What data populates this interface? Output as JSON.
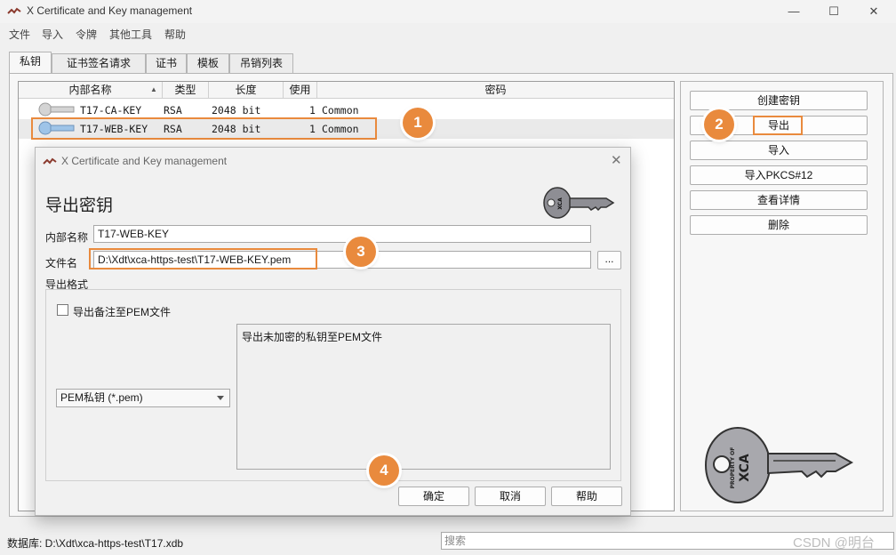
{
  "window": {
    "title": "X Certificate and Key management"
  },
  "menu": [
    "文件",
    "导入",
    "令牌",
    "其他工具",
    "帮助"
  ],
  "tabs": [
    "私钥",
    "证书签名请求",
    "证书",
    "模板",
    "吊销列表"
  ],
  "table": {
    "columns": [
      "内部名称",
      "类型",
      "长度",
      "使用",
      "密码"
    ],
    "rows": [
      {
        "name": "T17-CA-KEY",
        "type": "RSA",
        "length": "2048 bit",
        "use": "1",
        "password": "Common"
      },
      {
        "name": "T17-WEB-KEY",
        "type": "RSA",
        "length": "2048 bit",
        "use": "1",
        "password": "Common"
      }
    ]
  },
  "side_buttons": [
    "创建密钥",
    "导出",
    "导入",
    "导入PKCS#12",
    "查看详情",
    "删除"
  ],
  "dialog": {
    "title": "X Certificate and Key management",
    "heading": "导出密钥",
    "internal_name_label": "内部名称",
    "internal_name_value": "T17-WEB-KEY",
    "filename_label": "文件名",
    "filename_value": "D:\\Xdt\\xca-https-test\\T17-WEB-KEY.pem",
    "browse_label": "...",
    "format_label": "导出格式",
    "checkbox_label": "导出备注至PEM文件",
    "format_selected": "PEM私钥 (*.pem)",
    "description": "导出未加密的私钥至PEM文件",
    "ok_label": "确定",
    "cancel_label": "取消",
    "help_label": "帮助"
  },
  "status": {
    "database": "数据库: D:\\Xdt\\xca-https-test\\T17.xdb",
    "search_placeholder": "搜索",
    "watermark": "CSDN @明台"
  },
  "markers": [
    "1",
    "2",
    "3",
    "4"
  ],
  "key_emblem": {
    "top": "XCA",
    "side": "PROPERTY OF",
    "main": "XCA"
  },
  "colors": {
    "accent": "#e98a3d",
    "key_gray": "#9a9aa0",
    "key_blue": "#9ec4e8"
  }
}
